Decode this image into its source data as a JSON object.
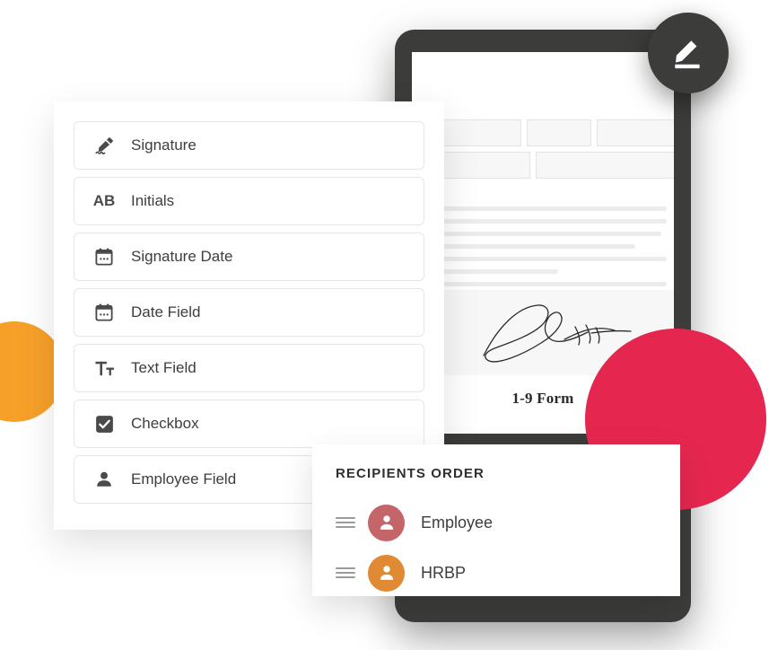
{
  "colors": {
    "accent_orange": "#f6a02a",
    "accent_crimson": "#e5274f",
    "device_frame": "#3c3c3b",
    "avatar_employee": "#c4656a",
    "avatar_hrbp": "#e08a33",
    "text_primary": "#3d3d3d"
  },
  "edit_button": {
    "icon": "pencil-edit-icon",
    "label": "Edit"
  },
  "fields_panel": {
    "items": [
      {
        "label": "Signature",
        "icon": "signature-pen-icon"
      },
      {
        "label": "Initials",
        "icon": "initials-ab-icon"
      },
      {
        "label": "Signature Date",
        "icon": "calendar-icon"
      },
      {
        "label": "Date Field",
        "icon": "calendar-icon"
      },
      {
        "label": "Text Field",
        "icon": "text-format-icon"
      },
      {
        "label": "Checkbox",
        "icon": "checkbox-checked-icon"
      },
      {
        "label": "Employee Field",
        "icon": "person-icon"
      }
    ],
    "initials_glyph": "AB"
  },
  "document": {
    "title": "1-9 Form",
    "signature_alt": "handwritten-signature",
    "boxes": [
      "",
      "",
      "",
      "",
      ""
    ],
    "line_widths": [
      "96%",
      "96%",
      "94%",
      "83%",
      "96%",
      "50%",
      "96%",
      "49%"
    ]
  },
  "recipients_panel": {
    "title": "RECIPIENTS ORDER",
    "items": [
      {
        "name": "Employee",
        "avatar_color": "#c4656a",
        "handle": "drag-handle-icon"
      },
      {
        "name": "HRBP",
        "avatar_color": "#e08a33",
        "handle": "drag-handle-icon"
      }
    ]
  }
}
